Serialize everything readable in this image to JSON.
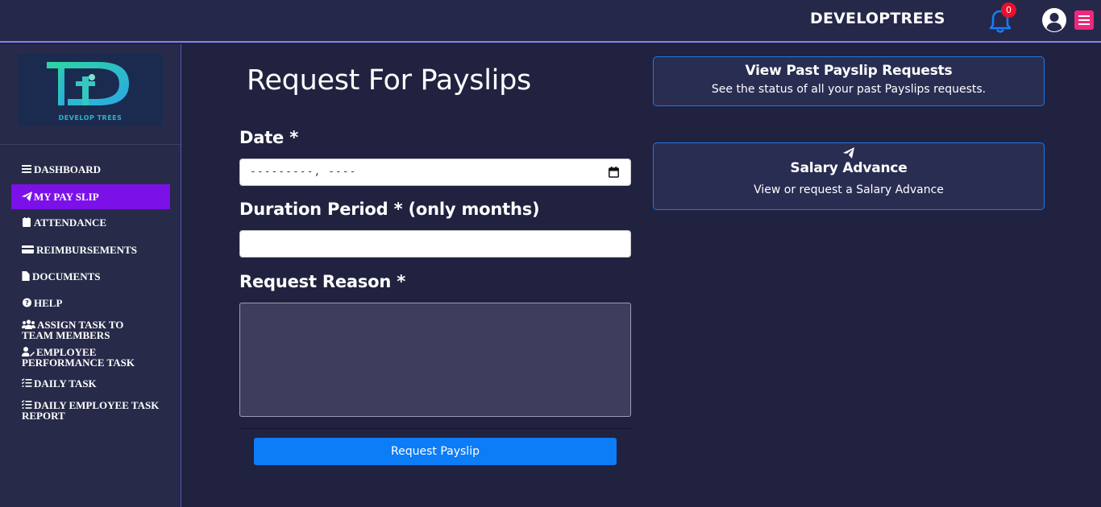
{
  "header": {
    "brand": "DEVELOPTREES",
    "notification_count": "0"
  },
  "sidebar": {
    "logo_alt": "DEVELOPTREES",
    "items": [
      {
        "label": "DASHBOARD",
        "icon": "bars-icon"
      },
      {
        "label": "MY PAY SLIP",
        "icon": "paper-plane-icon",
        "active": true
      },
      {
        "label": "ATTENDANCE",
        "icon": "calendar-icon"
      },
      {
        "label": "REIMBURSEMENTS",
        "icon": "credit-card-icon"
      },
      {
        "label": "DOCUMENTS",
        "icon": "file-icon"
      },
      {
        "label": "HELP",
        "icon": "question-circle-icon"
      },
      {
        "label": "ASSIGN TASK TO TEAM MEMBERS",
        "icon": "users-icon"
      },
      {
        "label": "EMPLOYEE PERFORMANCE TASK",
        "icon": "user-edit-icon"
      },
      {
        "label": "DAILY TASK",
        "icon": "task-list-icon"
      },
      {
        "label": "DAILY EMPLOYEE TASK REPORT",
        "icon": "task-list-icon"
      }
    ]
  },
  "form": {
    "title": "Request For Payslips",
    "date_label": "Date *",
    "date_placeholder": "---------, ----",
    "duration_label": "Duration Period * (only months)",
    "duration_value": "",
    "reason_label": "Request Reason *",
    "reason_value": "",
    "submit_label": "Request Payslip"
  },
  "cards": {
    "past_requests": {
      "title": "View Past Payslip Requests",
      "subtitle": "See the status of all your past Payslips requests."
    },
    "salary_advance": {
      "title": "Salary Advance",
      "subtitle": "View or request a Salary Advance",
      "icon": "paper-plane-icon"
    }
  },
  "colors": {
    "active_nav": "#7c10e8",
    "primary_button": "#0d7cf7",
    "badge": "#e8102c",
    "menu_button": "#f0277b",
    "card_border": "#1e78e8"
  }
}
